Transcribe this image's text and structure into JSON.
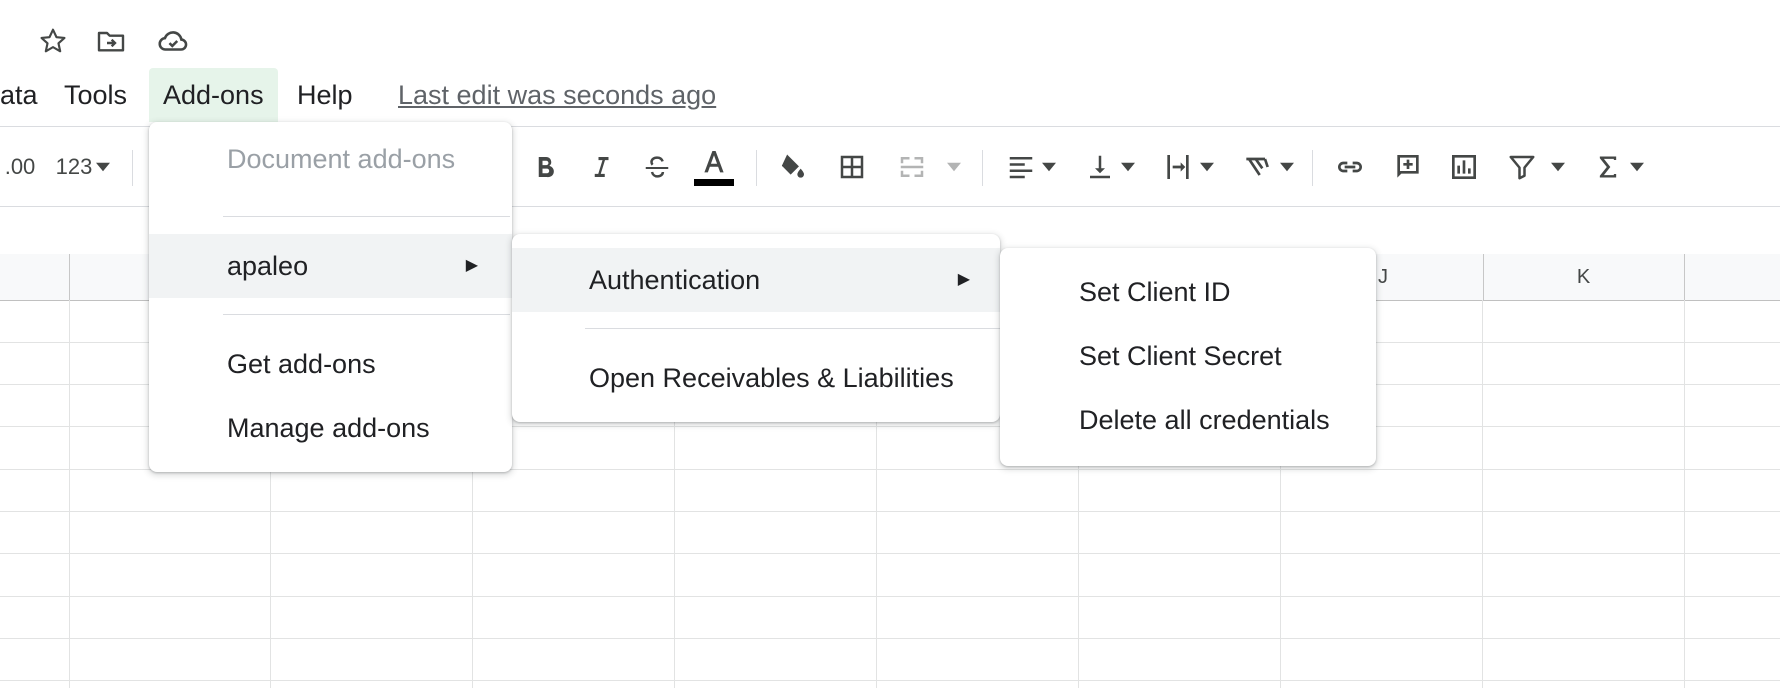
{
  "header_icons": [
    "star-icon",
    "move-to-folder-icon",
    "cloud-saved-icon"
  ],
  "menubar": {
    "items": [
      {
        "label": "ata",
        "name": "menu-data"
      },
      {
        "label": "Tools",
        "name": "menu-tools"
      },
      {
        "label": "Add-ons",
        "name": "menu-addons",
        "active": true
      },
      {
        "label": "Help",
        "name": "menu-help"
      }
    ],
    "last_edit": "Last edit was seconds ago"
  },
  "toolbar": {
    "decimal_label": ".00",
    "format_label": "123",
    "text_color": "#000000"
  },
  "columns": [
    "J",
    "K"
  ],
  "addons_menu": {
    "document_addons": "Document add-ons",
    "apaleo": "apaleo",
    "get_addons": "Get add-ons",
    "manage_addons": "Manage add-ons"
  },
  "apaleo_menu": {
    "authentication": "Authentication",
    "open_receivables": "Open Receivables & Liabilities"
  },
  "auth_menu": {
    "set_client_id": "Set Client ID",
    "set_client_secret": "Set Client Secret",
    "delete_credentials": "Delete all credentials"
  },
  "submenu_arrow": "▶",
  "colors": {
    "active_menu_bg": "#e6f4ea",
    "hover_bg": "#f1f3f4",
    "disabled_text": "#9aa0a6"
  }
}
